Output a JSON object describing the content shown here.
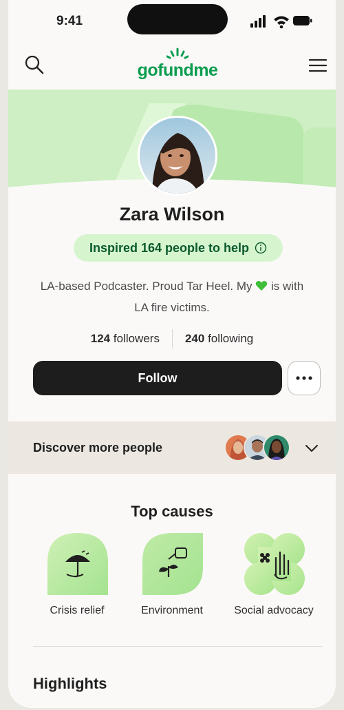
{
  "status_bar": {
    "time": "9:41"
  },
  "header": {
    "logo_text": "gofundme"
  },
  "profile": {
    "name": "Zara Wilson",
    "inspired_text": "Inspired 164 people to help",
    "bio_before": "LA-based Podcaster. Proud Tar Heel. My",
    "bio_after": "is with LA fire victims.",
    "followers_count": "124",
    "followers_label": "followers",
    "following_count": "240",
    "following_label": "following",
    "follow_label": "Follow"
  },
  "discover": {
    "label": "Discover more people"
  },
  "top_causes": {
    "title": "Top causes",
    "items": [
      {
        "label": "Crisis relief",
        "icon": "umbrella-hand-icon"
      },
      {
        "label": "Environment",
        "icon": "watering-can-icon"
      },
      {
        "label": "Social advocacy",
        "icon": "hand-flower-icon"
      }
    ]
  },
  "highlights": {
    "title": "Highlights"
  },
  "colors": {
    "brand_green": "#0b9d4f",
    "light_green": "#d6f5cf",
    "button_dark": "#1d1d1d",
    "discover_bg": "#ece7e1"
  }
}
